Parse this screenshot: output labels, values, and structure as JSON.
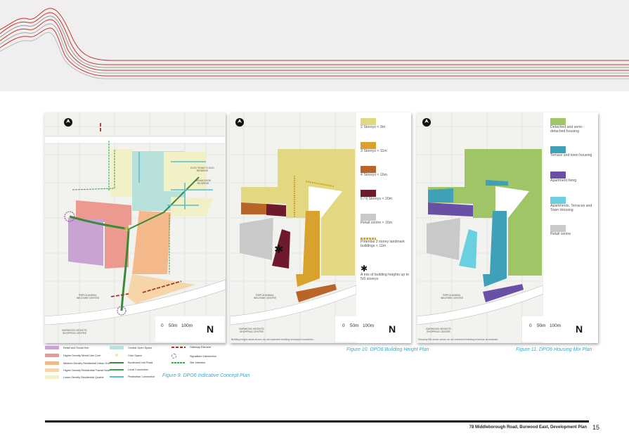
{
  "figure9": {
    "caption": "Figure 9. DPO6 Indicative Concept Plan",
    "labels": {
      "reserve": "ELGY ROAD FLOOD RESERVE",
      "donald": "DONALDSON RESERVE",
      "rspca": "RSPCA ANIMAL WELFARE CENTRE",
      "shopping": "BURWOOD HEIGHTS SHOPPING CENTRE"
    },
    "legend": [
      {
        "label": "Retail and Social Hub",
        "color": "#c9a3d2"
      },
      {
        "label": "Higher Density Mixed Use Core",
        "color": "#ec9a8f"
      },
      {
        "label": "Medium Density Residential Urban Grid",
        "color": "#f4b98a"
      },
      {
        "label": "Higher Density Residential Transit Node",
        "color": "#f6d5a8"
      },
      {
        "label": "Lower Density Residential Quarter",
        "color": "#f1f0c6"
      },
      {
        "label": "Central Open Space",
        "color": "#b9e1dc"
      },
      {
        "label": "Civic Space",
        "color": "#f2d23c"
      },
      {
        "label": "Boulevard Link Road",
        "color": "#3a8a3a"
      },
      {
        "label": "Local Connection",
        "color": "#3aa54a"
      },
      {
        "label": "Pedestrian Connection",
        "color": "#5bbccc"
      },
      {
        "label": "Gateway Element",
        "color": "#b03028"
      },
      {
        "label": "Signalised Intersection",
        "color": "#9a5cb0"
      },
      {
        "label": "Site Interface",
        "color": "#3aa54a"
      }
    ]
  },
  "figure10": {
    "caption": "Figure 10. DPO6 Building Height Plan",
    "note": "Building height areas shown do not represent building envelope boundaries.",
    "labels": {
      "rspca": "RSPCA ANIMAL WELFARE CENTRE",
      "shopping": "BURWOOD HEIGHTS SHOPPING CENTRE"
    },
    "legend": [
      {
        "label": "2 Storeys < 9m",
        "color": "#e2d882"
      },
      {
        "label": "3 Storeys < 11m",
        "color": "#d9a12e"
      },
      {
        "label": "4 Storeys < 16m",
        "color": "#b9652a"
      },
      {
        "label": "5 / 6 Storeys < 20m",
        "color": "#6e1a2c"
      },
      {
        "label": "Retail centre < 16m",
        "color": "#c9c9c9"
      },
      {
        "label": "Potential 3 storey landmark buildings < 11m",
        "color": "#d9a12e"
      },
      {
        "label": "A mix of building heights up to 5/6 storeys",
        "color": "#111111"
      }
    ]
  },
  "figure11": {
    "caption": "Figure 11. DPO6 Housing Mix Plan",
    "note": "Housing Mix areas shown do not represent building envelope boundaries.",
    "labels": {
      "rspca": "RSPCA ANIMAL WELFARE CENTRE",
      "shopping": "BURWOOD HEIGHTS SHOPPING CENTRE"
    },
    "legend": [
      {
        "label": "Detached and semi-detached housing",
        "color": "#9fc566"
      },
      {
        "label": "Terrace and town housing",
        "color": "#3fa0b8"
      },
      {
        "label": "Apartment living",
        "color": "#6a4fa6"
      },
      {
        "label": "Apartments, Terraces and Town Housing",
        "color": "#6ad0e0"
      },
      {
        "label": "Retail centre",
        "color": "#c9c9c9"
      }
    ]
  },
  "scale": {
    "s0": "0",
    "s1": "50m",
    "s2": "100m",
    "north": "N"
  },
  "footer": {
    "title": "78 Middleborough Road, Burwood East, Development Plan",
    "page": "15"
  }
}
